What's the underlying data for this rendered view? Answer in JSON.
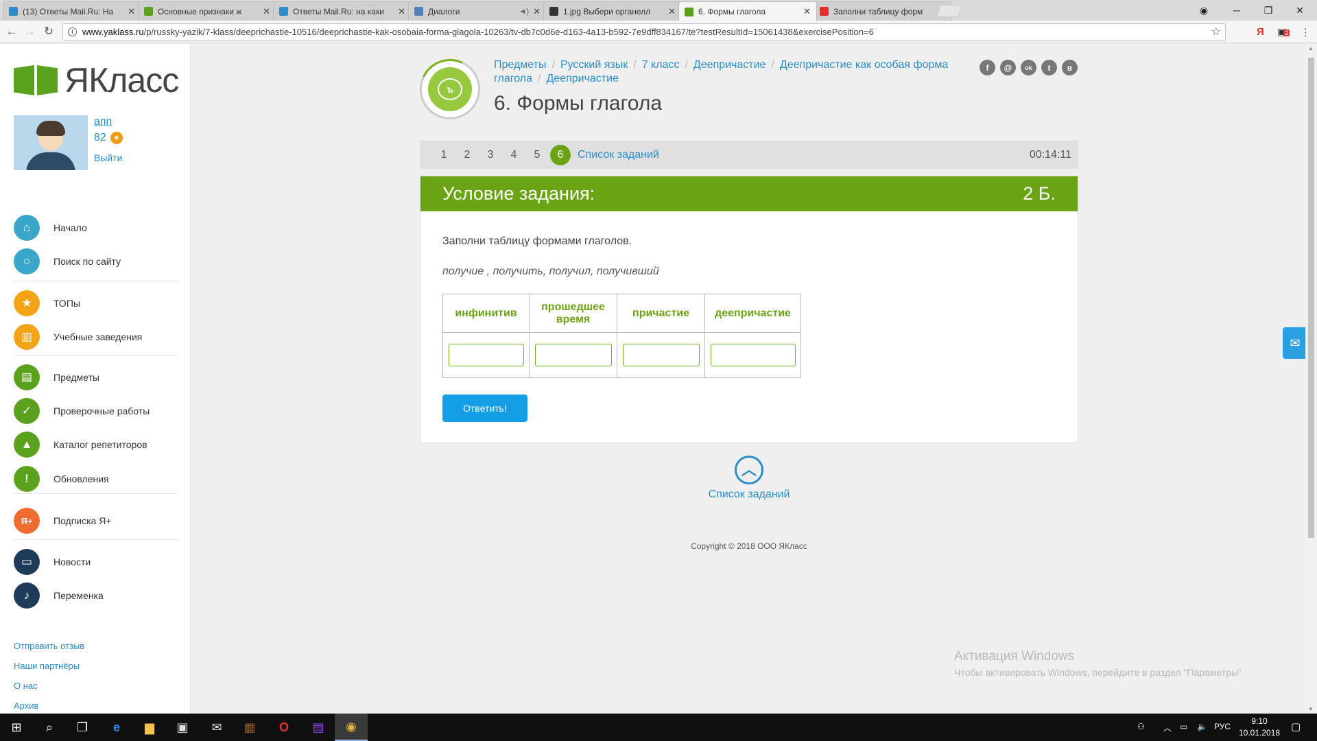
{
  "browser": {
    "tabs": [
      {
        "title": "(13) Ответы Mail.Ru: На",
        "color": "#2a8dcb",
        "icon": "question-icon"
      },
      {
        "title": "Основные признаки ж",
        "color": "#5aa21e",
        "icon": "book-icon"
      },
      {
        "title": "Ответы Mail.Ru: на каки",
        "color": "#2a8dcb",
        "icon": "question-icon"
      },
      {
        "title": "Диалоги",
        "color": "#5181b8",
        "icon": "play-icon"
      },
      {
        "title": "1.jpg Выбери органелл",
        "color": "#333333",
        "icon": "z-icon"
      },
      {
        "title": "6. Формы глагола",
        "color": "#5aa21e",
        "icon": "book-icon",
        "active": true
      },
      {
        "title": "Заполни таблицу форм",
        "color": "#e62e2e",
        "icon": "yandex-icon"
      }
    ],
    "url_host": "www.yaklass.ru",
    "url_path": "/p/russky-yazik/7-klass/deeprichastie-10516/deeprichastie-kak-osobaia-forma-glagola-10263/tv-db7c0d6e-d163-4a13-b592-7e9dff834167/te?testResultId=15061438&exercisePosition=6",
    "ext_badge": "2"
  },
  "sidebar": {
    "logo_text": "ЯКласс",
    "user": {
      "name": "апп",
      "points": "82",
      "logout": "Выйти"
    },
    "menu": [
      {
        "label": "Начало",
        "color": "#3aa6c9",
        "icon": "home-icon",
        "glyph": "⌂"
      },
      {
        "label": "Поиск по сайту",
        "color": "#3aa6c9",
        "icon": "search-icon",
        "glyph": "○"
      },
      {
        "label": "ТОПы",
        "color": "#f2a318",
        "icon": "star-icon",
        "glyph": "★"
      },
      {
        "label": "Учебные заведения",
        "color": "#f2a318",
        "icon": "building-icon",
        "glyph": "▥"
      },
      {
        "label": "Предметы",
        "color": "#5aa21e",
        "icon": "book-icon",
        "glyph": "▤"
      },
      {
        "label": "Проверочные работы",
        "color": "#5aa21e",
        "icon": "check-icon",
        "glyph": "✓"
      },
      {
        "label": "Каталог репетиторов",
        "color": "#5aa21e",
        "icon": "graduation-cap-icon",
        "glyph": "▲"
      },
      {
        "label": "Обновления",
        "color": "#5aa21e",
        "icon": "exclamation-icon",
        "glyph": "!"
      },
      {
        "label": "Подписка Я+",
        "color": "#ef6b2e",
        "icon": "ya-plus-icon",
        "glyph": "Я+"
      },
      {
        "label": "Новости",
        "color": "#1f3b59",
        "icon": "chat-icon",
        "glyph": "▭"
      },
      {
        "label": "Переменка",
        "color": "#1f3b59",
        "icon": "bell-icon",
        "glyph": "♪"
      }
    ],
    "footer_links": [
      "Отправить отзыв",
      "Наши партнёры",
      "О нас",
      "Архив"
    ]
  },
  "main": {
    "breadcrumb": [
      "Предметы",
      "Русский язык",
      "7 класс",
      "Деепричастие",
      "Деепричастие как особая форма глагола",
      "Деепричастие"
    ],
    "title": "6. Формы глагола",
    "social": [
      {
        "icon": "facebook-icon",
        "glyph": "f"
      },
      {
        "icon": "mailru-icon",
        "glyph": "@"
      },
      {
        "icon": "odnoklassniki-icon",
        "glyph": "ok"
      },
      {
        "icon": "twitter-icon",
        "glyph": "t"
      },
      {
        "icon": "vk-icon",
        "glyph": "в"
      }
    ],
    "task_numbers": [
      "1",
      "2",
      "3",
      "4",
      "5",
      "6"
    ],
    "current_task": "6",
    "task_list_label": "Список заданий",
    "timer": "00:14:11",
    "task": {
      "header": "Условие задания:",
      "score": "2 Б.",
      "instruction": "Заполни таблицу формами глаголов.",
      "words": "получие , получить, получил, получивший",
      "columns": [
        "инфинитив",
        "прошедшее время",
        "причастие",
        "деепричастие"
      ],
      "values": [
        "",
        "",
        "",
        ""
      ],
      "submit": "Ответить!"
    },
    "up_label": "Список заданий",
    "copyright": "Copyright © 2018 ООО ЯКласс"
  },
  "watermark": {
    "title": "Активация Windows",
    "text": "Чтобы активировать Windows, перейдите в раздел \"Параметры\"."
  },
  "taskbar": {
    "lang": "РУС",
    "time": "9:10",
    "date": "10.01.2018"
  },
  "colors": {
    "accent_green": "#6aa313",
    "link_blue": "#2a8dcb",
    "button_blue": "#139ee6"
  }
}
